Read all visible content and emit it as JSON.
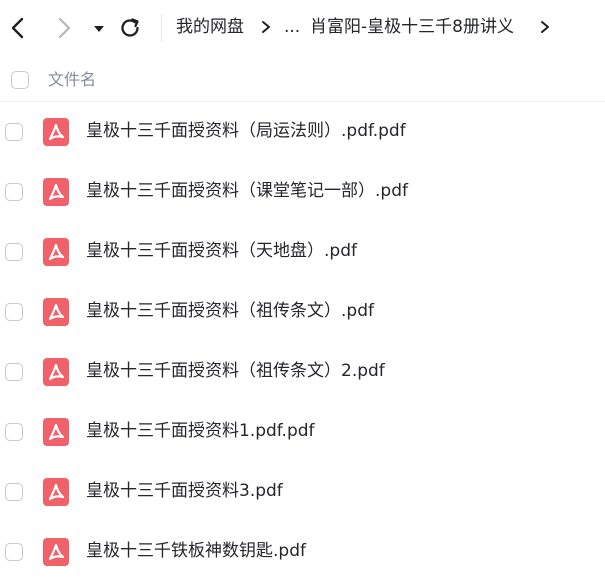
{
  "toolbar": {
    "icons": [
      "arrow-left-icon",
      "arrow-right-icon",
      "caret-down-icon",
      "refresh-icon"
    ]
  },
  "breadcrumb": {
    "root": "我的网盘",
    "ellipsis": "...",
    "current": "肖富阳-皇极十三千8册讲义",
    "separator_icon": "chevron-right-icon"
  },
  "list_header": {
    "name_label": "文件名"
  },
  "files": [
    {
      "name": "皇极十三千面授资料（局运法则）.pdf.pdf",
      "icon": "pdf-icon"
    },
    {
      "name": "皇极十三千面授资料（课堂笔记一部）.pdf",
      "icon": "pdf-icon"
    },
    {
      "name": "皇极十三千面授资料（天地盘）.pdf",
      "icon": "pdf-icon"
    },
    {
      "name": "皇极十三千面授资料（祖传条文）.pdf",
      "icon": "pdf-icon"
    },
    {
      "name": "皇极十三千面授资料（祖传条文）2.pdf",
      "icon": "pdf-icon"
    },
    {
      "name": "皇极十三千面授资料1.pdf.pdf",
      "icon": "pdf-icon"
    },
    {
      "name": "皇极十三千面授资料3.pdf",
      "icon": "pdf-icon"
    },
    {
      "name": "皇极十三千铁板神数钥匙.pdf",
      "icon": "pdf-icon"
    }
  ],
  "colors": {
    "pdf_icon": "#f1616a",
    "text": "#25262b",
    "muted_text": "#878c9c",
    "checkbox_border": "#c9c9cf",
    "disabled_icon": "#b4b6be"
  }
}
